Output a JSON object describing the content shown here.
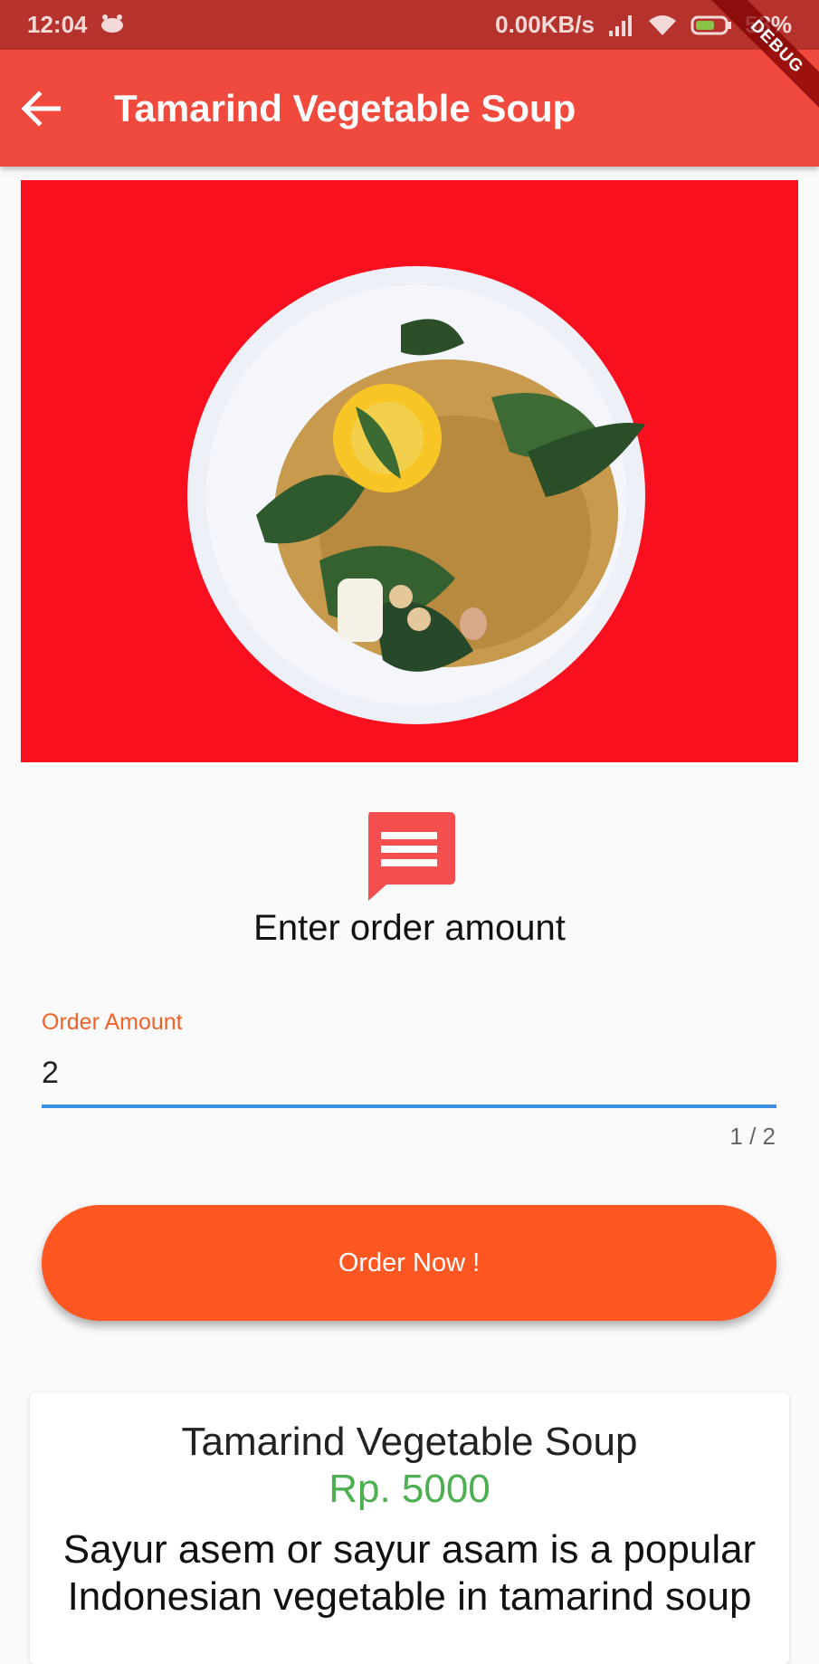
{
  "status_bar": {
    "time": "12:04",
    "network_speed": "0.00KB/s",
    "battery": "58%"
  },
  "app_bar": {
    "title": "Tamarind Vegetable Soup",
    "debug_banner": "DEBUG"
  },
  "hero": {
    "description": "Bowl of tamarind vegetable soup on red background"
  },
  "order_form": {
    "prompt": "Enter order amount",
    "field_label": "Order Amount",
    "field_value": "2",
    "counter": "1 / 2",
    "button_label": "Order Now !"
  },
  "product": {
    "name": "Tamarind Vegetable Soup",
    "price": "Rp. 5000",
    "description": "Sayur asem or sayur asam is a popular Indonesian vegetable in tamarind soup"
  },
  "colors": {
    "app_bar": "#f04a3f",
    "status_bar": "#b5332c",
    "accent": "#fe5722",
    "price": "#4caf50",
    "input_underline": "#3b8fe0"
  }
}
